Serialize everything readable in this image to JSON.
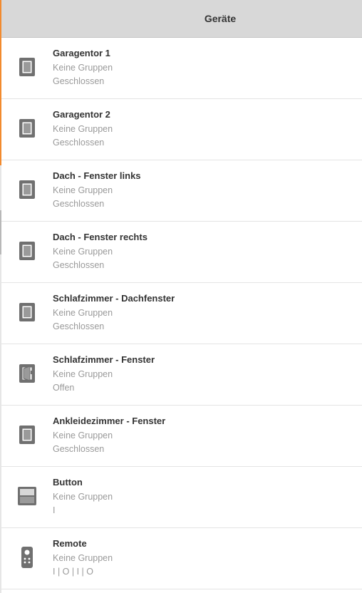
{
  "header": {
    "title": "Geräte"
  },
  "colors": {
    "accent": "#f28a2e",
    "header_bg": "#d8d8d8",
    "icon": "#707070",
    "secondary_text": "#9a9a9a"
  },
  "devices": [
    {
      "name": "Garagentor 1",
      "groups": "Keine Gruppen",
      "state": "Geschlossen",
      "icon": "window-closed-icon"
    },
    {
      "name": "Garagentor 2",
      "groups": "Keine Gruppen",
      "state": "Geschlossen",
      "icon": "window-closed-icon"
    },
    {
      "name": "Dach - Fenster links",
      "groups": "Keine Gruppen",
      "state": "Geschlossen",
      "icon": "window-closed-icon"
    },
    {
      "name": "Dach - Fenster rechts",
      "groups": "Keine Gruppen",
      "state": "Geschlossen",
      "icon": "window-closed-icon"
    },
    {
      "name": "Schlafzimmer - Dachfenster",
      "groups": "Keine Gruppen",
      "state": "Geschlossen",
      "icon": "window-closed-icon"
    },
    {
      "name": "Schlafzimmer - Fenster",
      "groups": "Keine Gruppen",
      "state": "Offen",
      "icon": "window-open-icon"
    },
    {
      "name": "Ankleidezimmer - Fenster",
      "groups": "Keine Gruppen",
      "state": "Geschlossen",
      "icon": "window-closed-icon"
    },
    {
      "name": "Button",
      "groups": "Keine Gruppen",
      "state": "I",
      "icon": "button-switch-icon"
    },
    {
      "name": "Remote",
      "groups": "Keine Gruppen",
      "state": "I | O | I | O",
      "icon": "remote-control-icon"
    }
  ]
}
